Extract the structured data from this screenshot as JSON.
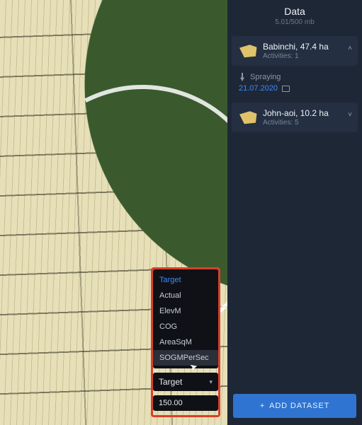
{
  "panel": {
    "title": "Data",
    "storage": "5.01/500 mb",
    "fields": [
      {
        "name": "Babinchi, 47.4 ha",
        "activities_label": "Activities: 1",
        "expanded": true
      },
      {
        "name": "John-aoi, 10.2 ha",
        "activities_label": "Activities: 5",
        "expanded": false
      }
    ],
    "activity": {
      "type_label": "Spraying",
      "date": "21.07.2020"
    },
    "add_button": "ADD DATASET"
  },
  "menu": {
    "items": [
      {
        "label": "Target",
        "state": "selected"
      },
      {
        "label": "Actual",
        "state": ""
      },
      {
        "label": "ElevM",
        "state": ""
      },
      {
        "label": "COG",
        "state": ""
      },
      {
        "label": "AreaSqM",
        "state": ""
      },
      {
        "label": "SOGMPerSec",
        "state": "hover"
      }
    ],
    "selected_label": "Target",
    "value": "150.00"
  }
}
